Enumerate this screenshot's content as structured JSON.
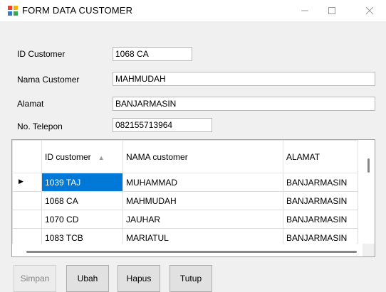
{
  "window": {
    "title": "FORM DATA CUSTOMER"
  },
  "form": {
    "id_label": "ID Customer",
    "id_value": "1068 CA",
    "nama_label": "Nama Customer",
    "nama_value": "MAHMUDAH",
    "alamat_label": "Alamat",
    "alamat_value": "BANJARMASIN",
    "telepon_label": "No. Telepon",
    "telepon_value": "082155713964"
  },
  "grid": {
    "columns": [
      "ID customer",
      "NAMA customer",
      "ALAMAT"
    ],
    "rows": [
      [
        "1039 TAJ",
        "MUHAMMAD",
        "BANJARMASIN"
      ],
      [
        "1068 CA",
        "MAHMUDAH",
        "BANJARMASIN"
      ],
      [
        "1070 CD",
        "JAUHAR",
        "BANJARMASIN"
      ],
      [
        "1083 TCB",
        "MARIATUL",
        "BANJARMASIN"
      ]
    ],
    "selected_row": 0
  },
  "buttons": {
    "simpan": "Simpan",
    "ubah": "Ubah",
    "hapus": "Hapus",
    "tutup": "Tutup"
  }
}
